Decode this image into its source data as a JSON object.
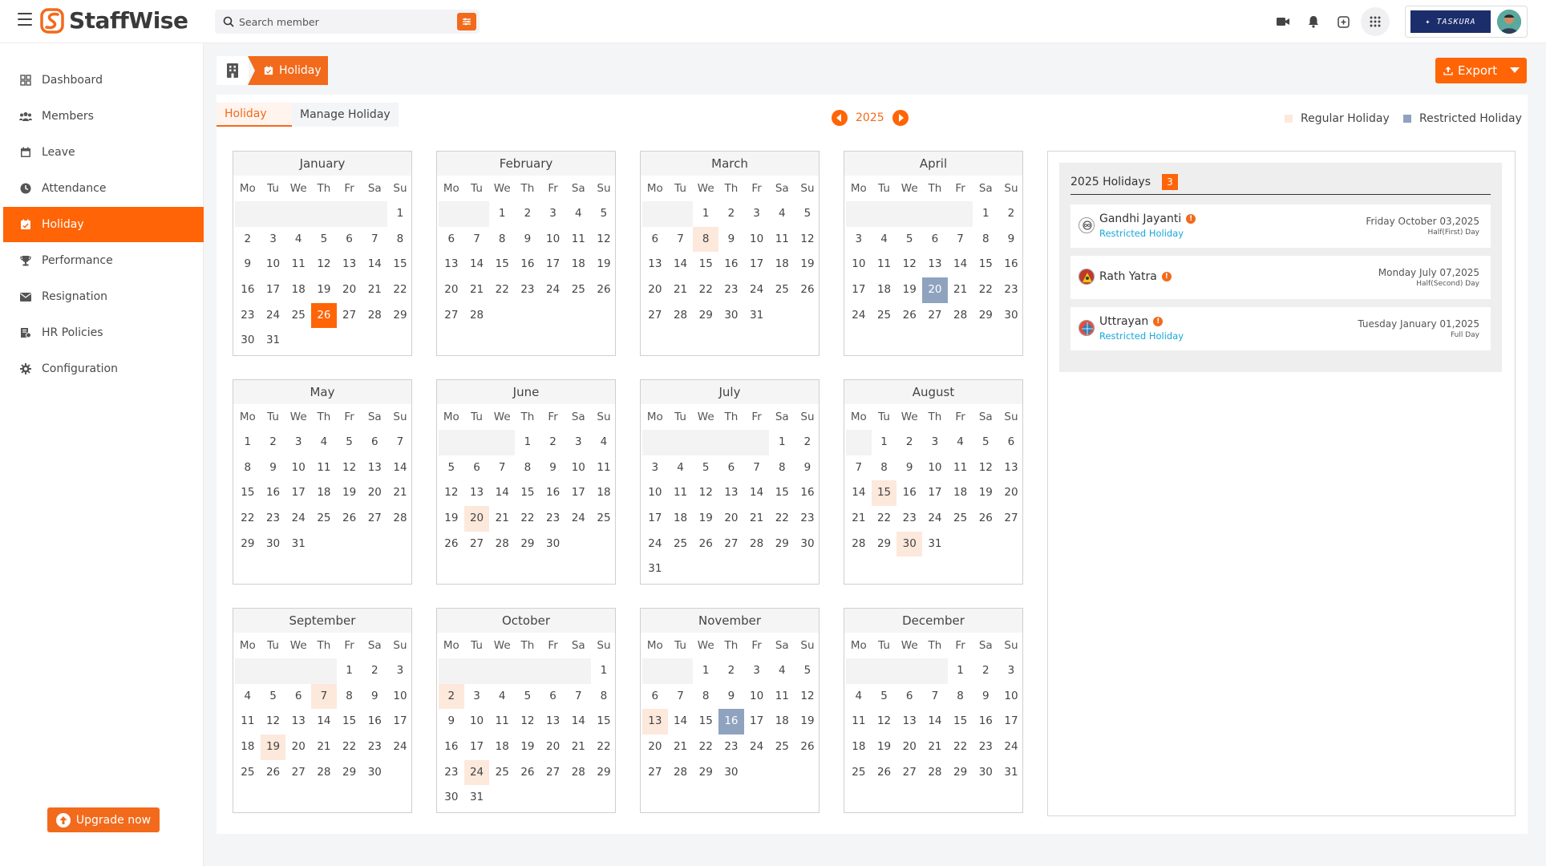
{
  "header": {
    "brand": "StaffWise",
    "search_placeholder": "Search member",
    "org_logo_text": "TASKURA"
  },
  "sidebar": {
    "items": [
      {
        "label": "Dashboard",
        "icon": "grid-icon"
      },
      {
        "label": "Members",
        "icon": "users-icon"
      },
      {
        "label": "Leave",
        "icon": "calendar-icon"
      },
      {
        "label": "Attendance",
        "icon": "clock-icon"
      },
      {
        "label": "Holiday",
        "icon": "calendar-check-icon"
      },
      {
        "label": "Performance",
        "icon": "trophy-icon"
      },
      {
        "label": "Resignation",
        "icon": "envelope-icon"
      },
      {
        "label": "HR Policies",
        "icon": "policy-book-icon"
      },
      {
        "label": "Configuration",
        "icon": "gear-icon"
      }
    ],
    "active_index": 4,
    "upgrade_label": "Upgrade now"
  },
  "breadcrumb": {
    "current": "Holiday"
  },
  "toolbar": {
    "export_label": "Export"
  },
  "tabs": [
    {
      "label": "Holiday",
      "active": true
    },
    {
      "label": "Manage Holiday",
      "active": false
    }
  ],
  "year_nav": {
    "year": "2025"
  },
  "legend": {
    "regular_label": "Regular Holiday",
    "restricted_label": "Restricted Holiday",
    "regular_color": "#fde8dc",
    "restricted_color": "#8fa3bf"
  },
  "weekdays": [
    "Mo",
    "Tu",
    "We",
    "Th",
    "Fr",
    "Sa",
    "Su"
  ],
  "calendar": {
    "months": [
      {
        "name": "January",
        "offset": 6,
        "days": 31,
        "regular": [],
        "restricted": [],
        "today": 26
      },
      {
        "name": "February",
        "offset": 2,
        "days": 28,
        "regular": [],
        "restricted": []
      },
      {
        "name": "March",
        "offset": 2,
        "days": 31,
        "regular": [
          8
        ],
        "restricted": []
      },
      {
        "name": "April",
        "offset": 5,
        "days": 30,
        "regular": [],
        "restricted": [
          20
        ]
      },
      {
        "name": "May",
        "offset": 0,
        "days": 31,
        "regular": [],
        "restricted": []
      },
      {
        "name": "June",
        "offset": 3,
        "days": 30,
        "regular": [
          20
        ],
        "restricted": []
      },
      {
        "name": "July",
        "offset": 5,
        "days": 31,
        "regular": [],
        "restricted": []
      },
      {
        "name": "August",
        "offset": 1,
        "days": 31,
        "regular": [
          15,
          30
        ],
        "restricted": []
      },
      {
        "name": "September",
        "offset": 4,
        "days": 30,
        "regular": [
          7,
          19
        ],
        "restricted": []
      },
      {
        "name": "October",
        "offset": 6,
        "days": 31,
        "regular": [
          2,
          24
        ],
        "restricted": []
      },
      {
        "name": "November",
        "offset": 2,
        "days": 30,
        "regular": [
          13
        ],
        "restricted": [
          16
        ]
      },
      {
        "name": "December",
        "offset": 4,
        "days": 31,
        "regular": [],
        "restricted": []
      }
    ]
  },
  "holiday_list": {
    "title": "2025 Holidays",
    "count": "3",
    "items": [
      {
        "name": "Gandhi Jayanti",
        "type": "Restricted Holiday",
        "date": "Friday October 03,2025",
        "duration": "Half(First) Day"
      },
      {
        "name": "Rath Yatra",
        "type": "",
        "date": "Monday July 07,2025",
        "duration": "Half(Second) Day"
      },
      {
        "name": "Uttrayan",
        "type": "Restricted Holiday",
        "date": "Tuesday January 01,2025",
        "duration": "Full Day"
      }
    ]
  }
}
